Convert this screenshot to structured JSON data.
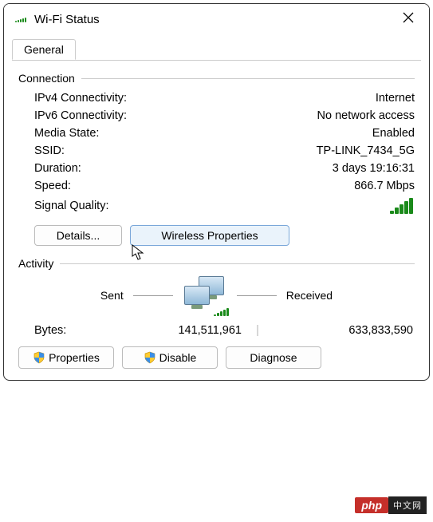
{
  "window": {
    "title": "Wi-Fi Status"
  },
  "tabs": {
    "general": "General"
  },
  "connection": {
    "legend": "Connection",
    "ipv4_label": "IPv4 Connectivity:",
    "ipv4_value": "Internet",
    "ipv6_label": "IPv6 Connectivity:",
    "ipv6_value": "No network access",
    "media_label": "Media State:",
    "media_value": "Enabled",
    "ssid_label": "SSID:",
    "ssid_value": "TP-LINK_7434_5G",
    "duration_label": "Duration:",
    "duration_value": "3 days 19:16:31",
    "speed_label": "Speed:",
    "speed_value": "866.7 Mbps",
    "signal_label": "Signal Quality:",
    "details_btn": "Details...",
    "wprops_btn": "Wireless Properties"
  },
  "activity": {
    "legend": "Activity",
    "sent_label": "Sent",
    "received_label": "Received",
    "bytes_label": "Bytes:",
    "bytes_sent": "141,511,961",
    "bytes_received": "633,833,590"
  },
  "bottom": {
    "properties": "Properties",
    "disable": "Disable",
    "diagnose": "Diagnose"
  },
  "watermark": {
    "brand": "php",
    "cn": "中文网"
  }
}
